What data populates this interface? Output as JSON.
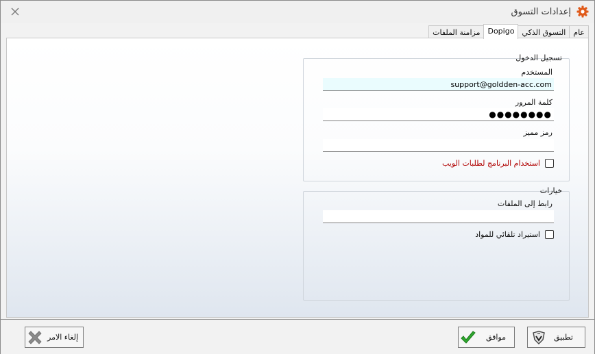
{
  "window": {
    "title": "إعدادات التسوق"
  },
  "tabs": [
    {
      "label": "عام"
    },
    {
      "label": "التسوق الذكي"
    },
    {
      "label": "Dopigo"
    },
    {
      "label": "مزامنة الملفات"
    }
  ],
  "login": {
    "title": "تسجيل الدخول",
    "username_label": "المستخدم",
    "username_value": "support@goldden-acc.com",
    "password_label": "كلمة المرور",
    "password_value": "●●●●●●●●",
    "token_label": "رمز مميز",
    "token_value": "",
    "web_orders_label": "استخدام البرنامج لطلبات الويب"
  },
  "options": {
    "title": "خيارات",
    "files_link_label": "رابط إلى الملفات",
    "files_link_value": "",
    "auto_import_label": "استيراد تلقائي للمواد"
  },
  "footer": {
    "apply_label": "تطبيق",
    "ok_label": "موافق",
    "cancel_label": "إلغاء الامر"
  },
  "colors": {
    "accent_icon": "#e05a1a",
    "ok_check": "#2fa82f",
    "cancel_x": "#8a8a8a",
    "warning_text": "#b00000"
  }
}
